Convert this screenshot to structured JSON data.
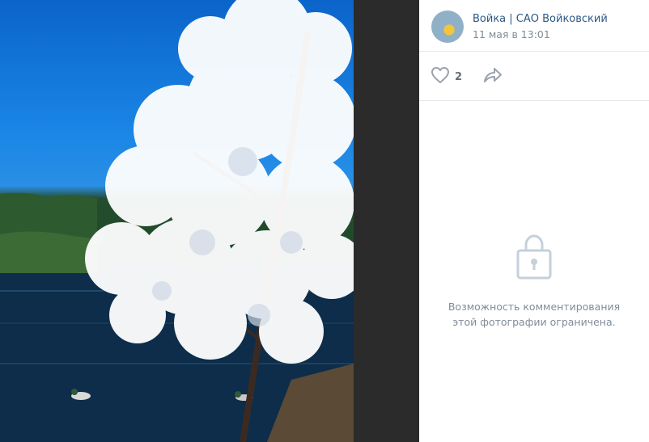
{
  "post": {
    "author": "Войка | САО Войковский",
    "date": "11 мая в 13:01"
  },
  "actions": {
    "likes_count": "2"
  },
  "comments": {
    "restricted_message": "Возможность комментирования этой фотографии ограничена."
  },
  "icons": {
    "like": "heart-icon",
    "share": "share-arrow-icon",
    "lock": "lock-icon"
  },
  "colors": {
    "link": "#2a5885",
    "muted": "#818c99",
    "divider": "#e7e8ec",
    "viewer_bg": "#2b2b2b"
  }
}
